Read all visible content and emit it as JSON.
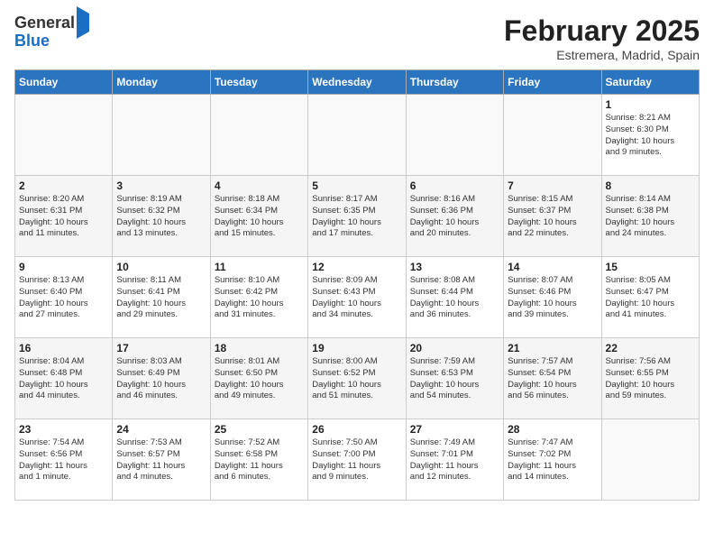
{
  "header": {
    "logo_line1": "General",
    "logo_line2": "Blue",
    "title": "February 2025",
    "subtitle": "Estremera, Madrid, Spain"
  },
  "days_of_week": [
    "Sunday",
    "Monday",
    "Tuesday",
    "Wednesday",
    "Thursday",
    "Friday",
    "Saturday"
  ],
  "weeks": [
    [
      {
        "day": "",
        "text": ""
      },
      {
        "day": "",
        "text": ""
      },
      {
        "day": "",
        "text": ""
      },
      {
        "day": "",
        "text": ""
      },
      {
        "day": "",
        "text": ""
      },
      {
        "day": "",
        "text": ""
      },
      {
        "day": "1",
        "text": "Sunrise: 8:21 AM\nSunset: 6:30 PM\nDaylight: 10 hours\nand 9 minutes."
      }
    ],
    [
      {
        "day": "2",
        "text": "Sunrise: 8:20 AM\nSunset: 6:31 PM\nDaylight: 10 hours\nand 11 minutes."
      },
      {
        "day": "3",
        "text": "Sunrise: 8:19 AM\nSunset: 6:32 PM\nDaylight: 10 hours\nand 13 minutes."
      },
      {
        "day": "4",
        "text": "Sunrise: 8:18 AM\nSunset: 6:34 PM\nDaylight: 10 hours\nand 15 minutes."
      },
      {
        "day": "5",
        "text": "Sunrise: 8:17 AM\nSunset: 6:35 PM\nDaylight: 10 hours\nand 17 minutes."
      },
      {
        "day": "6",
        "text": "Sunrise: 8:16 AM\nSunset: 6:36 PM\nDaylight: 10 hours\nand 20 minutes."
      },
      {
        "day": "7",
        "text": "Sunrise: 8:15 AM\nSunset: 6:37 PM\nDaylight: 10 hours\nand 22 minutes."
      },
      {
        "day": "8",
        "text": "Sunrise: 8:14 AM\nSunset: 6:38 PM\nDaylight: 10 hours\nand 24 minutes."
      }
    ],
    [
      {
        "day": "9",
        "text": "Sunrise: 8:13 AM\nSunset: 6:40 PM\nDaylight: 10 hours\nand 27 minutes."
      },
      {
        "day": "10",
        "text": "Sunrise: 8:11 AM\nSunset: 6:41 PM\nDaylight: 10 hours\nand 29 minutes."
      },
      {
        "day": "11",
        "text": "Sunrise: 8:10 AM\nSunset: 6:42 PM\nDaylight: 10 hours\nand 31 minutes."
      },
      {
        "day": "12",
        "text": "Sunrise: 8:09 AM\nSunset: 6:43 PM\nDaylight: 10 hours\nand 34 minutes."
      },
      {
        "day": "13",
        "text": "Sunrise: 8:08 AM\nSunset: 6:44 PM\nDaylight: 10 hours\nand 36 minutes."
      },
      {
        "day": "14",
        "text": "Sunrise: 8:07 AM\nSunset: 6:46 PM\nDaylight: 10 hours\nand 39 minutes."
      },
      {
        "day": "15",
        "text": "Sunrise: 8:05 AM\nSunset: 6:47 PM\nDaylight: 10 hours\nand 41 minutes."
      }
    ],
    [
      {
        "day": "16",
        "text": "Sunrise: 8:04 AM\nSunset: 6:48 PM\nDaylight: 10 hours\nand 44 minutes."
      },
      {
        "day": "17",
        "text": "Sunrise: 8:03 AM\nSunset: 6:49 PM\nDaylight: 10 hours\nand 46 minutes."
      },
      {
        "day": "18",
        "text": "Sunrise: 8:01 AM\nSunset: 6:50 PM\nDaylight: 10 hours\nand 49 minutes."
      },
      {
        "day": "19",
        "text": "Sunrise: 8:00 AM\nSunset: 6:52 PM\nDaylight: 10 hours\nand 51 minutes."
      },
      {
        "day": "20",
        "text": "Sunrise: 7:59 AM\nSunset: 6:53 PM\nDaylight: 10 hours\nand 54 minutes."
      },
      {
        "day": "21",
        "text": "Sunrise: 7:57 AM\nSunset: 6:54 PM\nDaylight: 10 hours\nand 56 minutes."
      },
      {
        "day": "22",
        "text": "Sunrise: 7:56 AM\nSunset: 6:55 PM\nDaylight: 10 hours\nand 59 minutes."
      }
    ],
    [
      {
        "day": "23",
        "text": "Sunrise: 7:54 AM\nSunset: 6:56 PM\nDaylight: 11 hours\nand 1 minute."
      },
      {
        "day": "24",
        "text": "Sunrise: 7:53 AM\nSunset: 6:57 PM\nDaylight: 11 hours\nand 4 minutes."
      },
      {
        "day": "25",
        "text": "Sunrise: 7:52 AM\nSunset: 6:58 PM\nDaylight: 11 hours\nand 6 minutes."
      },
      {
        "day": "26",
        "text": "Sunrise: 7:50 AM\nSunset: 7:00 PM\nDaylight: 11 hours\nand 9 minutes."
      },
      {
        "day": "27",
        "text": "Sunrise: 7:49 AM\nSunset: 7:01 PM\nDaylight: 11 hours\nand 12 minutes."
      },
      {
        "day": "28",
        "text": "Sunrise: 7:47 AM\nSunset: 7:02 PM\nDaylight: 11 hours\nand 14 minutes."
      },
      {
        "day": "",
        "text": ""
      }
    ]
  ]
}
